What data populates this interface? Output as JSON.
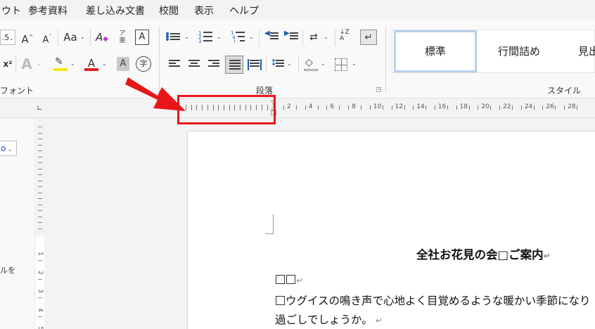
{
  "menu": [
    "ウト",
    "参考資料",
    "差し込み文書",
    "校閲",
    "表示",
    "ヘルプ"
  ],
  "font_group": {
    "size_partial": ".5",
    "grow": "A",
    "shrink": "A",
    "case": "Aa",
    "phonetic_top": "ア",
    "phonetic_bottom": "亜",
    "border_char": "A",
    "superscript": "x²",
    "effects": "A",
    "highlight": "ab",
    "font_color": "A",
    "shading_char": "A",
    "enclose_char": "字",
    "label": "フォント"
  },
  "paragraph_group": {
    "sort": "↓Z A",
    "label": "段落"
  },
  "styles_group": {
    "items": [
      "標準",
      "行間詰め",
      "見出"
    ],
    "label": "スタイル"
  },
  "navpane": {
    "close": "×",
    "dropdown_partial": "o",
    "text_partial": "ルを"
  },
  "ruler": {
    "numbers": [
      "2",
      "4",
      "6",
      "8",
      "10",
      "12",
      "14",
      "16",
      "18",
      "20",
      "22",
      "24",
      "26",
      "28"
    ]
  },
  "vruler": {
    "numbers": [
      "1",
      "2",
      "3",
      "4",
      "5"
    ]
  },
  "document": {
    "title": "全社お花見の会□ご案内",
    "para_mark": "↵",
    "line2_mark": "↵",
    "body1": "ウグイスの鳴き声で心地よく目覚めるような暖かい季節になり",
    "body2": "過ごしでしょうか。"
  },
  "colors": {
    "annotation_red": "#e8161b",
    "style_selected_border": "#b8d0ee",
    "bullet_blue": "#1a5fb4",
    "highlight_yellow": "#f5e600",
    "font_red": "#e01e1e"
  }
}
